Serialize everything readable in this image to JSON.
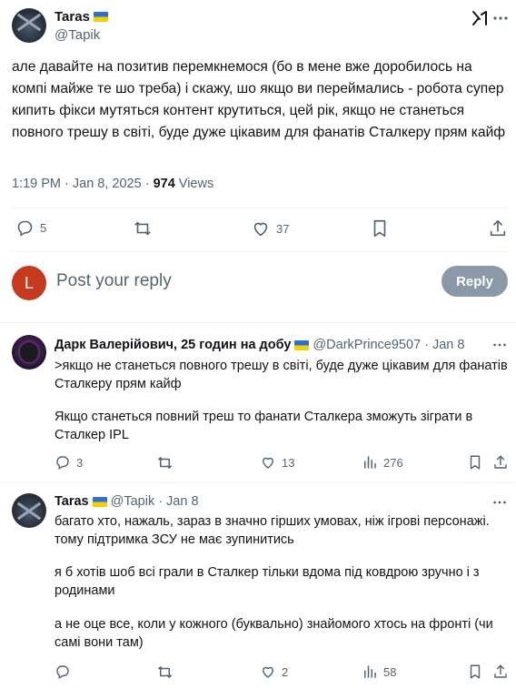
{
  "main_tweet": {
    "name": "Taras",
    "handle": "@Tapik",
    "text": "але давайте на позитив перемкнемося (бо в мене вже доробилось на компі майже те шо треба) і скажу, шо якщо ви переймались - робота супер кипить фікси мутяться контент крутиться, цей рік, якщо не станеться повного трешу в світі, буде дуже цікавим для фанатів Сталкеру прям кайф",
    "time": "1:19 PM · Jan 8, 2025 · ",
    "views_count": "974",
    "views_label": " Views",
    "replies": "5",
    "likes": "37"
  },
  "composer": {
    "avatar_letter": "L",
    "placeholder": "Post your reply",
    "reply_label": "Reply"
  },
  "replies": [
    {
      "name": "Дарк Валерійович, 25 годин на добу",
      "handle": "@DarkPrince9507",
      "date": "· Jan 8",
      "para1": ">якщо не станеться повного трешу в світі, буде дуже цікавим для фанатів Сталкеру прям кайф",
      "para2": "Якщо станеться повний треш то фанати Сталкера зможуть зіграти в Сталкер IPL",
      "replies": "3",
      "likes": "13",
      "views": "276"
    },
    {
      "name": "Taras",
      "handle": "@Tapik",
      "date": "· Jan 8",
      "para1": "багато хто, нажаль, зараз в значно гірших умовах, ніж ігрові персонажі. тому підтримка ЗСУ не має зупинитись",
      "para2": "я б хотів шоб всі грали в Сталкер тільки вдома під ковдрою зручно і з родинами",
      "para3": "а не оце все, коли у кожного (буквально) знайомого хтось на фронті (чи самі вони там)",
      "replies": "",
      "likes": "2",
      "views": "58"
    }
  ],
  "colors": {
    "text": "#0f1419",
    "secondary": "#536471",
    "divider": "#eff3f4",
    "reply_button": "#8b98a5",
    "avatar_L": "#c53a1e",
    "flag_blue": "#2f6fd0",
    "flag_yellow": "#f5d000"
  }
}
